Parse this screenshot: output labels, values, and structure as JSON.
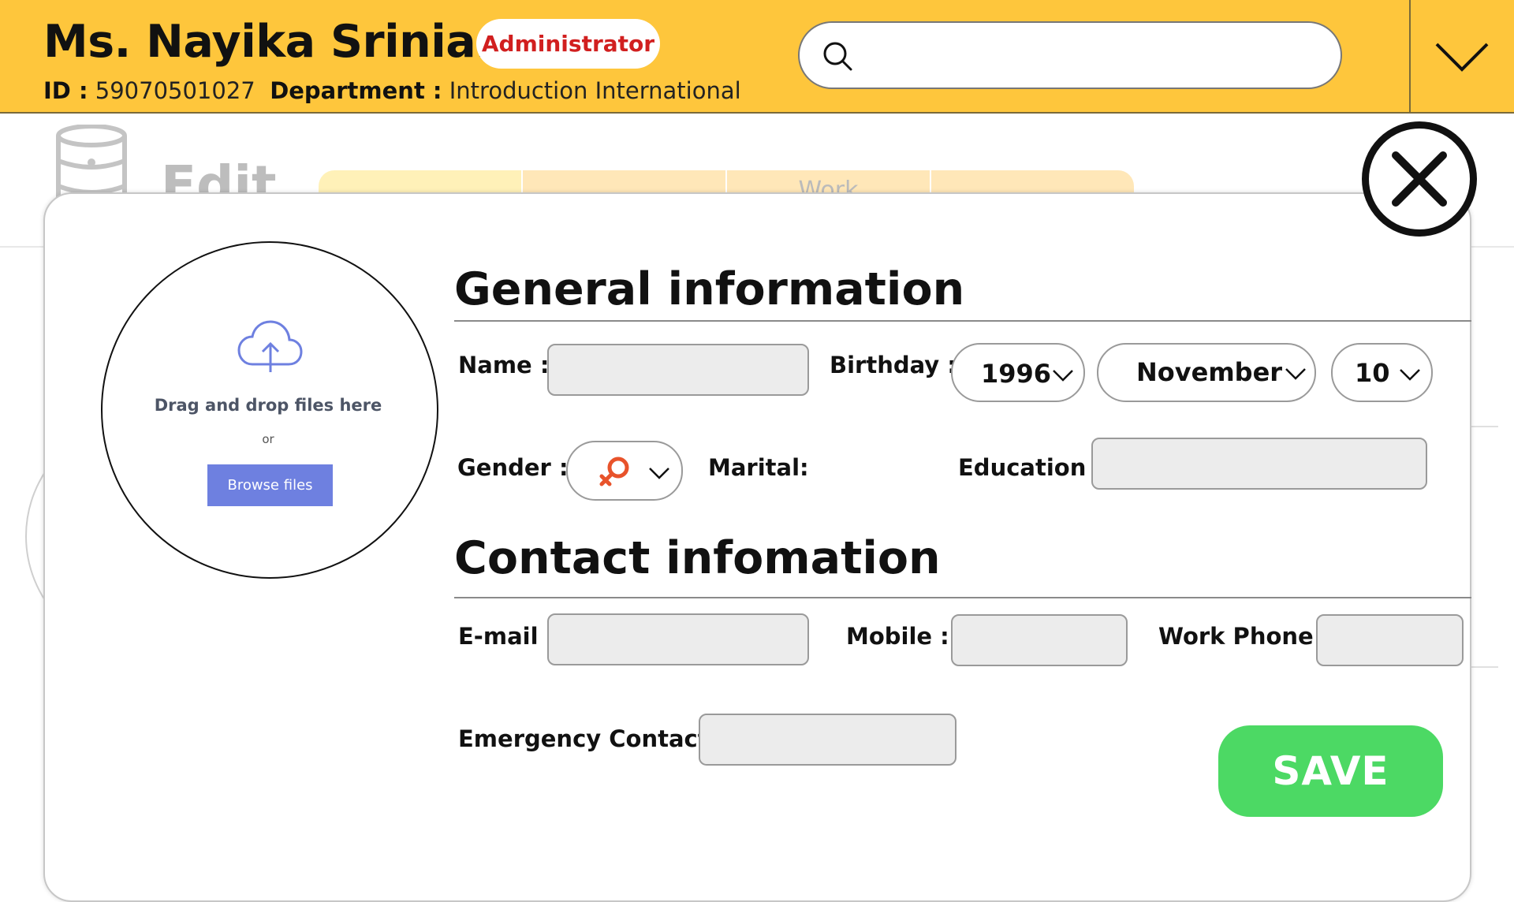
{
  "header": {
    "user_name": "Ms. Nayika Srinian",
    "role": "Administrator",
    "id_label": "ID :",
    "id_value": "59070501027",
    "department_label": "Department :",
    "department_value": "Introduction International",
    "search": {
      "value": "",
      "placeholder": ""
    },
    "background_color": "#FEC63C"
  },
  "background_page": {
    "title": "Edit",
    "tabs": [
      "",
      "",
      "Work",
      ""
    ]
  },
  "upload": {
    "drag_text": "Drag and drop files here",
    "or_text": "or",
    "browse_label": "Browse files"
  },
  "general": {
    "title": "General information",
    "name_label": "Name :",
    "name_value": "",
    "birthday_label": "Birthday :",
    "birth_year": "1996",
    "birth_month": "November",
    "birth_day": "10",
    "gender_label": "Gender :",
    "gender_icon": "female-symbol-icon",
    "marital_label": "Marital:",
    "education_label": "Education :",
    "education_value": ""
  },
  "contact": {
    "title": "Contact infomation",
    "email_label": "E-mail :",
    "email_value": "",
    "mobile_label": "Mobile :",
    "mobile_value": "",
    "work_phone_label": "Work Phone :",
    "work_phone_value": "",
    "emergency_label": "Emergency Contact :",
    "emergency_value": ""
  },
  "actions": {
    "save_label": "SAVE"
  },
  "colors": {
    "accent_yellow": "#FEC63C",
    "role_red": "#D11F1F",
    "save_green": "#4CD964",
    "browse_blue": "#6E80E0",
    "gender_orange": "#E8532B"
  }
}
